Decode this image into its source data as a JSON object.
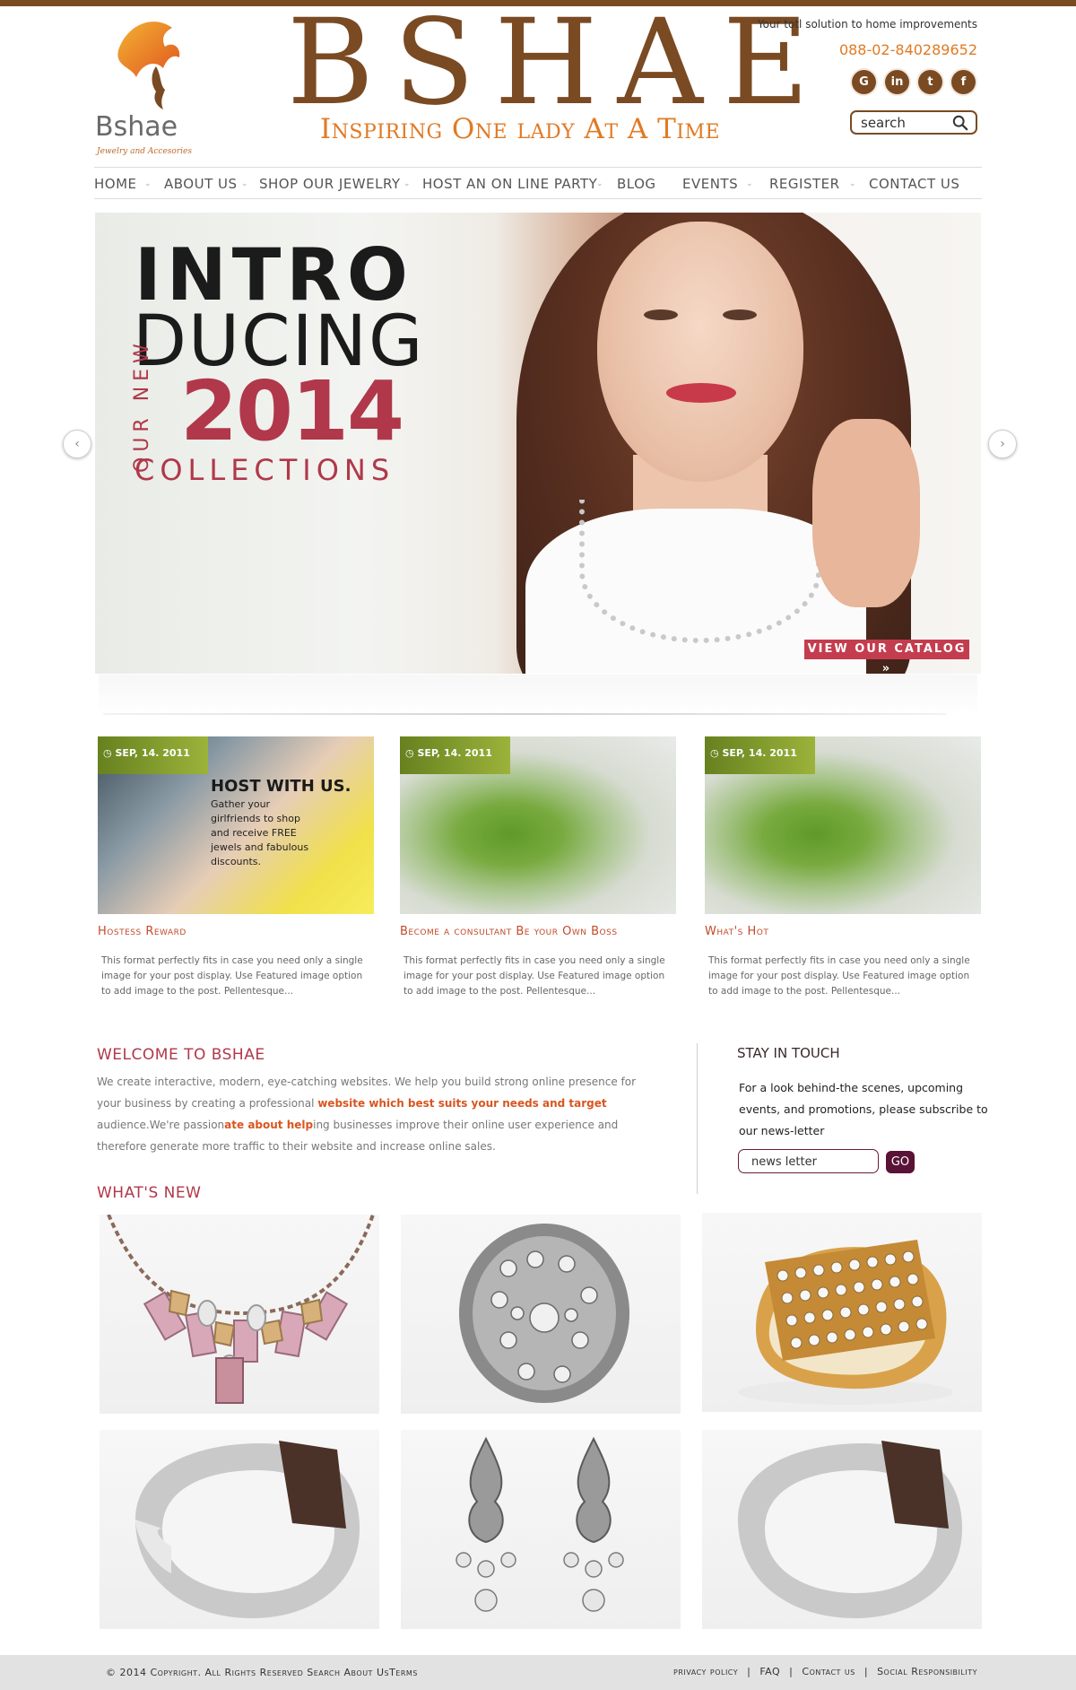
{
  "header": {
    "logo_name": "Bshae",
    "logo_tag": "Jewelry and Accesories",
    "brand": "BSHAE",
    "brand_tagline": "Inspiring One lady At A Time",
    "tagline": "Your totl solution to home improvements",
    "phone": "088-02-840289652",
    "social": [
      {
        "icon": "google-icon",
        "glyph": "G"
      },
      {
        "icon": "linkedin-icon",
        "glyph": "in"
      },
      {
        "icon": "twitter-icon",
        "glyph": "t"
      },
      {
        "icon": "facebook-icon",
        "glyph": "f"
      }
    ],
    "search_value": "search"
  },
  "nav": {
    "items": [
      "HOME",
      "ABOUT US",
      "SHOP OUR JEWELRY",
      "HOST AN ON LINE PARTY",
      "BLOG",
      "EVENTS",
      "REGISTER",
      "CONTACT US"
    ]
  },
  "hero": {
    "intro_line1": "INTRO",
    "intro_line2": "DUCING",
    "our_new": "OUR NEW",
    "year": "2014",
    "collections": "COLLECTIONS",
    "catalog_button": "VIEW OUR CATALOG »"
  },
  "posts": [
    {
      "date": "SEP, 14. 2011",
      "title": "Hostess Reward",
      "body": "This format perfectly fits in case you need only a single image for your post display. Use Featured image option to add image to the post. Pellentesque...",
      "img_heading": "HOST WITH US.",
      "img_text": "Gather your girlfriends to shop and receive FREE jewels and fabulous discounts."
    },
    {
      "date": "SEP, 14. 2011",
      "title": "Become a consultant Be your Own Boss",
      "body": "This format perfectly fits in case you need only a single image for your post display. Use Featured image option to add image to the post. Pellentesque..."
    },
    {
      "date": "SEP, 14. 2011",
      "title": "What's Hot",
      "body": "This format perfectly fits in case you need only a single image for your post display. Use Featured image option to add image to the post. Pellentesque..."
    }
  ],
  "welcome": {
    "title": "WELCOME TO BSHAE",
    "text_1": "We create interactive, modern, eye-catching websites. We help you build strong online presence for your business by creating a professional ",
    "highlight_1": "website which best suits your needs and target",
    "text_2": " audience.We're passion",
    "highlight_2": "ate about help",
    "text_3": "ing businesses improve their online user experience and therefore generate more traffic to their website and increase online sales."
  },
  "stay": {
    "title": "STAY IN TOUCH",
    "text": "For a look behind-the scenes, upcoming events, and promotions, please subscribe to our news-letter",
    "newsletter_value": "news letter",
    "go_label": "GO"
  },
  "whats_new": {
    "title": "WHAT'S NEW"
  },
  "footer": {
    "copyright": "© 2014 Copyright. All Rights  Reserved Search About UsTerms",
    "links": [
      "privacy policy",
      "FAQ",
      "Contact us",
      "Social Responsibility"
    ],
    "separator": "|"
  },
  "colors": {
    "brand_brown": "#7a4a23",
    "accent_orange": "#e07a24",
    "accent_red": "#b0384a",
    "date_green": "#7f9a2a",
    "go_button": "#5a1236"
  }
}
